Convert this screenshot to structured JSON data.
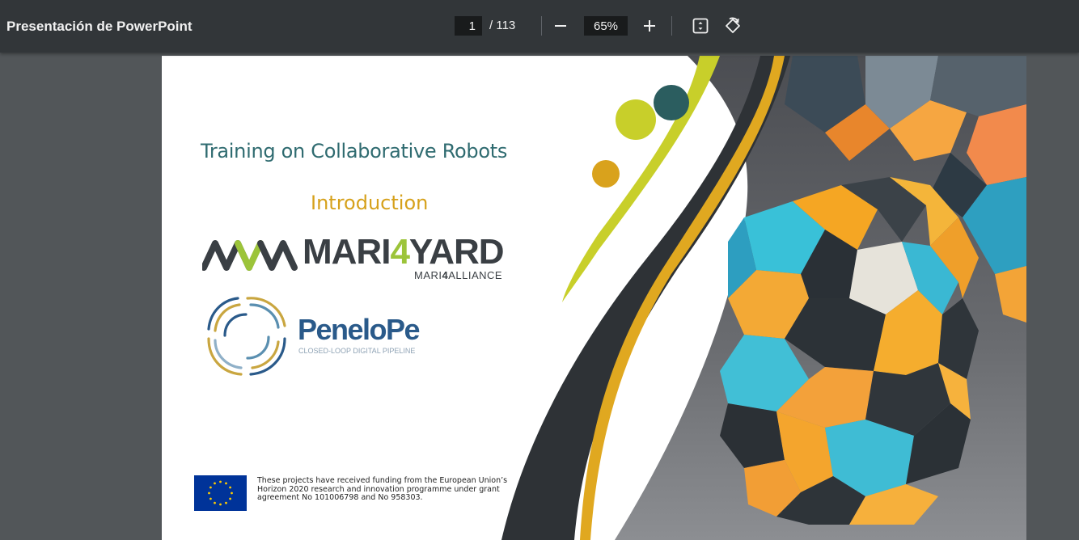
{
  "toolbar": {
    "title": "Presentación de PowerPoint",
    "page_current": "1",
    "page_total": "/ 113",
    "zoom": "65%",
    "icons": [
      "minus-icon",
      "plus-icon",
      "fit-page-icon",
      "rotate-icon"
    ]
  },
  "slide": {
    "title": "Training on Collaborative Robots",
    "subtitle": "Introduction",
    "mari_logo": {
      "prefix": "MARI",
      "digit": "4",
      "suffix": "YARD",
      "tagline_pre": "MARI",
      "tagline_digit": "4",
      "tagline_post": "ALLIANCE"
    },
    "penelope_logo": {
      "name": "PeneloPe",
      "tagline": "CLOSED-LOOP DIGITAL PIPELINE"
    },
    "funding_text": "These projects have received funding from the European Union’s Horizon 2020 research and innovation programme under grant agreement No 101006798 and No 958303."
  },
  "colors": {
    "toolbar_bg": "#323639",
    "viewer_bg": "#525659",
    "title_teal": "#2f6b70",
    "subtitle_gold": "#d6a11b",
    "accent_lime": "#c8cf2a",
    "wave_dark": "#2e3236",
    "eu_blue": "#003399"
  }
}
